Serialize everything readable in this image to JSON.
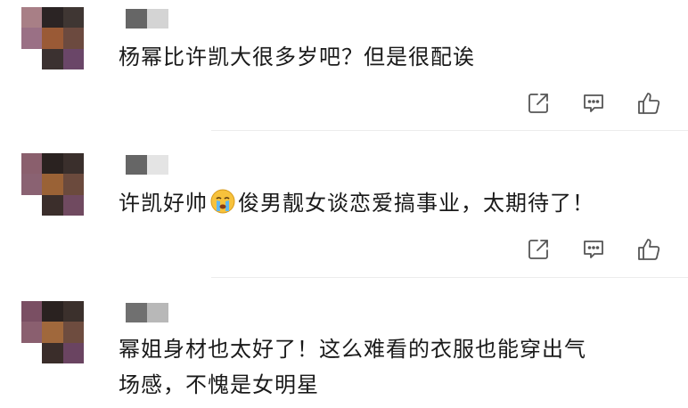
{
  "comments": [
    {
      "text": "杨幂比许凯大很多岁吧？但是很配诶",
      "avatar_colors": [
        "#a87f86",
        "#2b2424",
        "#3f3633",
        "#9a7085",
        "#9a5a36",
        "#6c4a3f",
        "#ffffff",
        "#3b3130",
        "#6a4668"
      ],
      "name_colors": [
        "#666666",
        "#d4d4d4"
      ]
    },
    {
      "text_before": "许凯好帅",
      "emoji": "crying-face-emoji",
      "text_after": "俊男靓女谈恋爱搞事业，太期待了！",
      "avatar_colors": [
        "#8a5f6d",
        "#2a2220",
        "#3a2f2c",
        "#8a6272",
        "#9a6236",
        "#6b4a3d",
        "#ffffff",
        "#3b2e2b",
        "#704a60"
      ],
      "name_colors": [
        "#666666",
        "#e4e4e4"
      ]
    },
    {
      "text_line1": "幂姐身材也太好了！这么难看的衣服也能穿出气",
      "text_line2": "场感，不愧是女明星",
      "avatar_colors": [
        "#7a4f63",
        "#2a2220",
        "#3b302c",
        "#8a5f6f",
        "#a0683c",
        "#6e4c3f",
        "#ffffff",
        "#3a2d2a",
        "#6a4461"
      ],
      "name_colors": [
        "#707070",
        "#b8b8b8"
      ]
    }
  ],
  "icons": {
    "share": "share-icon",
    "comment": "comment-icon",
    "like": "thumbs-up-icon"
  }
}
